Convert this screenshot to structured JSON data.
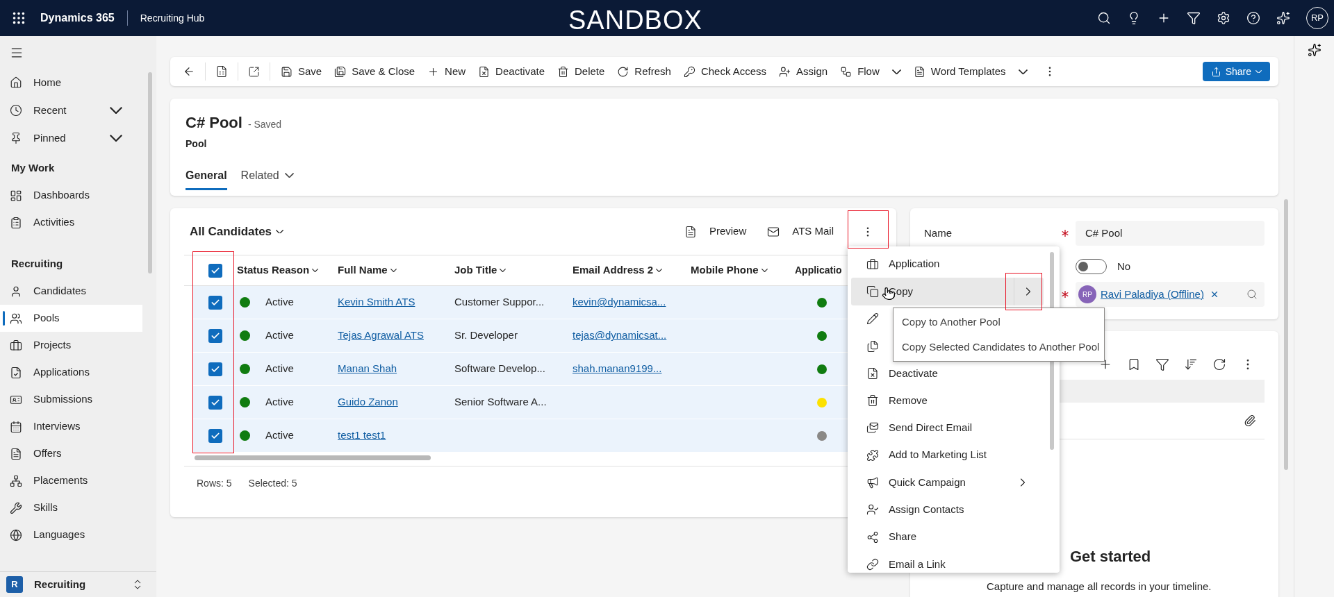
{
  "top_bar": {
    "app_name": "Dynamics 365",
    "area_name": "Recruiting Hub",
    "environment": "SANDBOX",
    "avatar": "RP"
  },
  "sidebar": {
    "top_items": [
      {
        "label": "Home",
        "expandable": false
      },
      {
        "label": "Recent",
        "expandable": true
      },
      {
        "label": "Pinned",
        "expandable": true
      }
    ],
    "sections": [
      {
        "title": "My Work",
        "items": [
          {
            "label": "Dashboards",
            "selected": false
          },
          {
            "label": "Activities",
            "selected": false
          }
        ]
      },
      {
        "title": "Recruiting",
        "items": [
          {
            "label": "Candidates",
            "selected": false
          },
          {
            "label": "Pools",
            "selected": true
          },
          {
            "label": "Projects",
            "selected": false
          },
          {
            "label": "Applications",
            "selected": false
          },
          {
            "label": "Submissions",
            "selected": false
          },
          {
            "label": "Interviews",
            "selected": false
          },
          {
            "label": "Offers",
            "selected": false
          },
          {
            "label": "Placements",
            "selected": false
          },
          {
            "label": "Skills",
            "selected": false
          },
          {
            "label": "Languages",
            "selected": false
          }
        ]
      }
    ],
    "area_switcher": {
      "badge": "R",
      "label": "Recruiting"
    }
  },
  "command_bar": {
    "commands": [
      {
        "label": "Save",
        "dropdown": false
      },
      {
        "label": "Save & Close",
        "dropdown": false
      },
      {
        "label": "New",
        "dropdown": false
      },
      {
        "label": "Deactivate",
        "dropdown": false
      },
      {
        "label": "Delete",
        "dropdown": false
      },
      {
        "label": "Refresh",
        "dropdown": false
      },
      {
        "label": "Check Access",
        "dropdown": false
      },
      {
        "label": "Assign",
        "dropdown": false
      },
      {
        "label": "Flow",
        "dropdown": true
      },
      {
        "label": "Word Templates",
        "dropdown": true
      }
    ],
    "share": "Share"
  },
  "header": {
    "title": "C# Pool",
    "status": "- Saved",
    "entity": "Pool",
    "tabs": [
      {
        "label": "General",
        "selected": true,
        "dropdown": false
      },
      {
        "label": "Related",
        "selected": false,
        "dropdown": true
      }
    ]
  },
  "grid": {
    "view": "All Candidates",
    "actions": [
      "Preview",
      "ATS Mail"
    ],
    "all_checked": true,
    "columns": [
      "Status Reason",
      "Full Name",
      "Job Title",
      "Email Address 2",
      "Mobile Phone",
      "Applicatio"
    ],
    "rows": [
      {
        "checked": true,
        "status": "Active",
        "name": "Kevin Smith ATS",
        "job": "Customer Suppor...",
        "email": "kevin@dynamicsa...",
        "color": "#107c10"
      },
      {
        "checked": true,
        "status": "Active",
        "name": "Tejas Agrawal ATS",
        "job": "Sr. Developer",
        "email": "tejas@dynamicsat...",
        "color": "#107c10"
      },
      {
        "checked": true,
        "status": "Active",
        "name": "Manan Shah",
        "job": "Software Develop...",
        "email": "shah.manan9199...",
        "color": "#107c10"
      },
      {
        "checked": true,
        "status": "Active",
        "name": "Guido Zanon",
        "job": "Senior Software A...",
        "color": "#fce100"
      },
      {
        "checked": true,
        "status": "Active",
        "name": "test1 test1",
        "color": "#8a8886"
      }
    ],
    "footer": [
      "Rows: 5",
      "Selected: 5"
    ]
  },
  "form": {
    "name_label": "Name",
    "name_required": true,
    "name_value": "C# Pool",
    "toggle_on": false,
    "toggle_label": "No",
    "owner_required": true,
    "owner_avatar": "RP",
    "owner": "Ravi Paladiya (Offline)"
  },
  "timeline": {
    "title": "Get started",
    "caption": "Capture and manage all records in your timeline."
  },
  "context_menu": {
    "items": [
      {
        "label": "Application",
        "highlighted": false,
        "submenu": false
      },
      {
        "label": "Copy",
        "highlighted": true,
        "submenu": true
      },
      {
        "highlighted": false
      },
      {
        "highlighted": false
      },
      {
        "label": "Deactivate",
        "highlighted": false,
        "submenu": false
      },
      {
        "label": "Remove",
        "highlighted": false,
        "submenu": false
      },
      {
        "label": "Send Direct Email",
        "highlighted": false,
        "submenu": false
      },
      {
        "label": "Add to Marketing List",
        "highlighted": false,
        "submenu": false
      },
      {
        "label": "Quick Campaign",
        "highlighted": false,
        "submenu": true
      },
      {
        "label": "Assign Contacts",
        "highlighted": false,
        "submenu": false
      },
      {
        "label": "Share",
        "highlighted": false,
        "submenu": false
      },
      {
        "label": "Email a Link",
        "highlighted": false,
        "submenu": false
      }
    ],
    "submenu": [
      "Copy to Another Pool",
      "Copy Selected Candidates to Another Pool"
    ]
  }
}
